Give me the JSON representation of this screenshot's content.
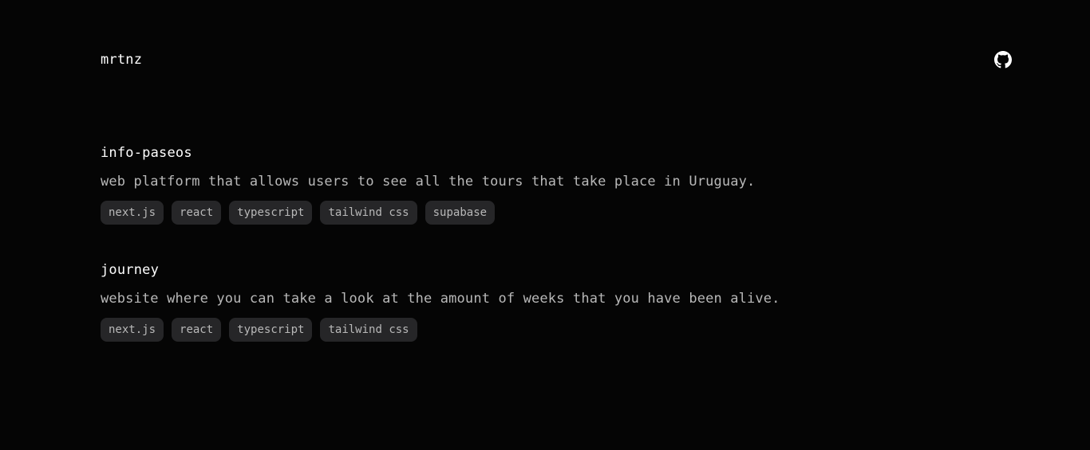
{
  "header": {
    "brand": "mrtnz",
    "github_icon": "github-icon"
  },
  "projects": [
    {
      "title": "info-paseos",
      "description": "web platform that allows users to see all the tours that take place in Uruguay.",
      "tags": [
        "next.js",
        "react",
        "typescript",
        "tailwind css",
        "supabase"
      ]
    },
    {
      "title": "journey",
      "description": "website where you can take a look at the amount of weeks that you have been alive.",
      "tags": [
        "next.js",
        "react",
        "typescript",
        "tailwind css"
      ]
    }
  ]
}
